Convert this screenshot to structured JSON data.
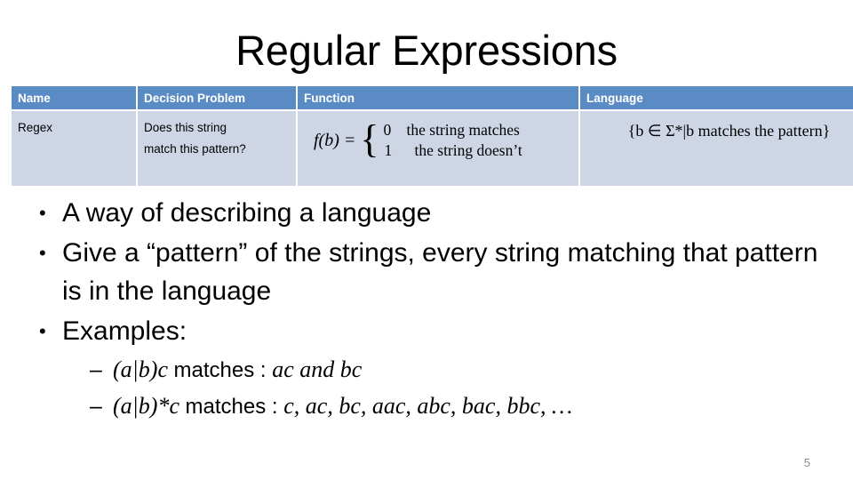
{
  "slide": {
    "title": "Regular Expressions",
    "page_number": "5",
    "accent_header_color": "#5b8bc4",
    "row_fill_color": "#ced6e5",
    "page_number_color": "#8d8d8d"
  },
  "table": {
    "columns": [
      "Name",
      "Decision Problem",
      "Function",
      "Language"
    ],
    "rows": [
      {
        "name": "Regex",
        "decision_problem": "Does this string match this pattern?",
        "function": {
          "lead": "f(b) =",
          "cases": [
            {
              "value": "0",
              "description": "the string matches"
            },
            {
              "value": "1",
              "description": "the string doesn’t"
            }
          ]
        },
        "language": "{b ∈ Σ*|b matches the pattern}"
      }
    ]
  },
  "content": {
    "bullets": [
      {
        "level": 1,
        "marker": "•",
        "text": "A way of describing a language"
      },
      {
        "level": 1,
        "marker": "•",
        "text": "Give a “pattern” of the strings, every string matching that pattern is in the language"
      },
      {
        "level": 1,
        "marker": "•",
        "text": "Examples:"
      }
    ],
    "examples": [
      {
        "marker": "–",
        "pattern": "(a|b)c",
        "verb": "matches : ",
        "results": "ac and bc"
      },
      {
        "marker": "–",
        "pattern": "(a|b)*c",
        "verb": "matches : ",
        "results": "c, ac, bc, aac, abc, bac, bbc, …"
      }
    ]
  }
}
